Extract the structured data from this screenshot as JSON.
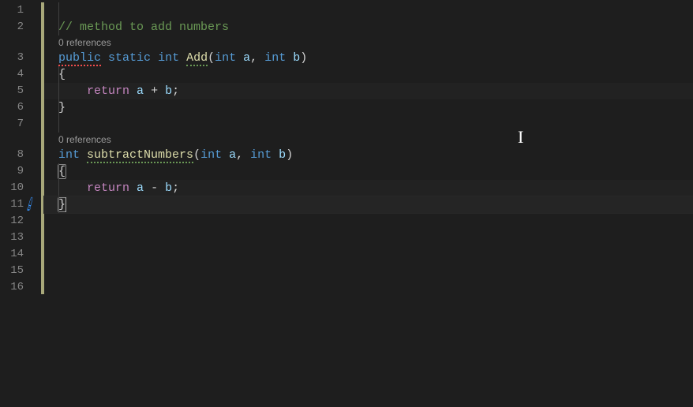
{
  "gutter": {
    "lines": [
      "1",
      "2",
      "3",
      "4",
      "5",
      "6",
      "7",
      "8",
      "9",
      "10",
      "11",
      "12",
      "13",
      "14",
      "15",
      "16"
    ]
  },
  "codelens": {
    "add": "0 references",
    "subtract": "0 references"
  },
  "code": {
    "line2_comment": "// method to add numbers",
    "line3_public": "public",
    "line3_static": "static",
    "line3_int1": "int",
    "line3_add": "Add",
    "line3_int2": "int",
    "line3_a": "a",
    "line3_int3": "int",
    "line3_b": "b",
    "line4_brace": "{",
    "line5_return": "return",
    "line5_a": "a",
    "line5_plus": " + ",
    "line5_b": "b",
    "line5_semi": ";",
    "line6_brace": "}",
    "line8_int1": "int",
    "line8_sub": "subtractNumbers",
    "line8_int2": "int",
    "line8_a": "a",
    "line8_int3": "int",
    "line8_b": "b",
    "line9_brace": "{",
    "line10_return": "return",
    "line10_a": "a",
    "line10_minus": " - ",
    "line10_b": "b",
    "line10_semi": ";",
    "line11_brace": "}"
  }
}
